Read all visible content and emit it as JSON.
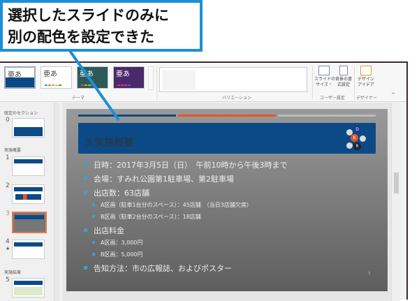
{
  "callout": {
    "line1": "選択したスライドのみに",
    "line2": "別の配色を設定できた"
  },
  "ribbon": {
    "themes": [
      {
        "label": "亜あ"
      },
      {
        "label": "亜あ"
      },
      {
        "label": "亜あ"
      },
      {
        "label": "亜あ"
      }
    ],
    "group_theme": "テーマ",
    "group_variation": "バリエーション",
    "slide_size": "スライドの\nサイズ・",
    "bg_format": "背景の書\n式設定",
    "design_ideas": "デザイン\nアイデア",
    "group_user": "ユーザー設定",
    "group_designer": "デザイナー"
  },
  "panel": {
    "sections": [
      "既定のセクション",
      "実施概要",
      "実施結果"
    ],
    "slides": [
      "0",
      "1",
      "2",
      "3",
      "4",
      "5"
    ],
    "star": "★"
  },
  "slide": {
    "title": "3.実施概要",
    "logo": [
      "D",
      "K",
      "R"
    ],
    "bullets": [
      {
        "level": 1,
        "text": "日時：2017年3月5日（日）　午前10時から午後3時まで"
      },
      {
        "level": 1,
        "text": "会場：すみれ公園第1駐車場、第2駐車場"
      },
      {
        "level": 1,
        "text": "出店数：63店舗"
      },
      {
        "level": 2,
        "text": "A区画（駐車1台分のスペース）：45店舗　（当日3店舗欠席）"
      },
      {
        "level": 2,
        "text": "B区画（駐車2台分のスペース）：18店舗"
      },
      {
        "level": 1,
        "text": "出店料金"
      },
      {
        "level": 2,
        "text": "A区画：3,000円"
      },
      {
        "level": 2,
        "text": "B区画：5,000円"
      },
      {
        "level": 1,
        "text": "告知方法：市の広報誌、およびポスター"
      }
    ],
    "page": "3"
  },
  "colors": {
    "accent": "#1d8fd6",
    "title_bar": "#0b4a86",
    "orange": "#e8542a",
    "selected": "#e8784a"
  }
}
